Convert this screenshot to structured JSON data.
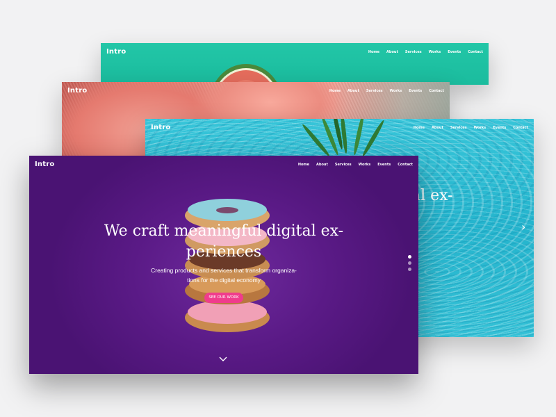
{
  "nav": {
    "logo": "Intro",
    "items": [
      "Home",
      "About",
      "Services",
      "Works",
      "Events",
      "Contact"
    ]
  },
  "slides": {
    "pool_partial_text": "al ex-"
  },
  "hero": {
    "headline_line1": "We craft meaningful digital ex-",
    "headline_line2": "periences",
    "sub_line1": "Creating products and services that transform organiza-",
    "sub_line2": "tions for the digital economy",
    "cta": "SEE OUR WORK"
  },
  "colors": {
    "watermelon_bg": "#1cc3a4",
    "coral_bg": "#e7857a",
    "pool_bg": "#2bbcd3",
    "purple_bg": "#5a1a86",
    "cta_pink": "#f03c8c"
  },
  "icons": {
    "next": "chevron-right-icon",
    "scroll": "chevron-down-icon"
  },
  "slider": {
    "count": 3,
    "active": 1
  }
}
